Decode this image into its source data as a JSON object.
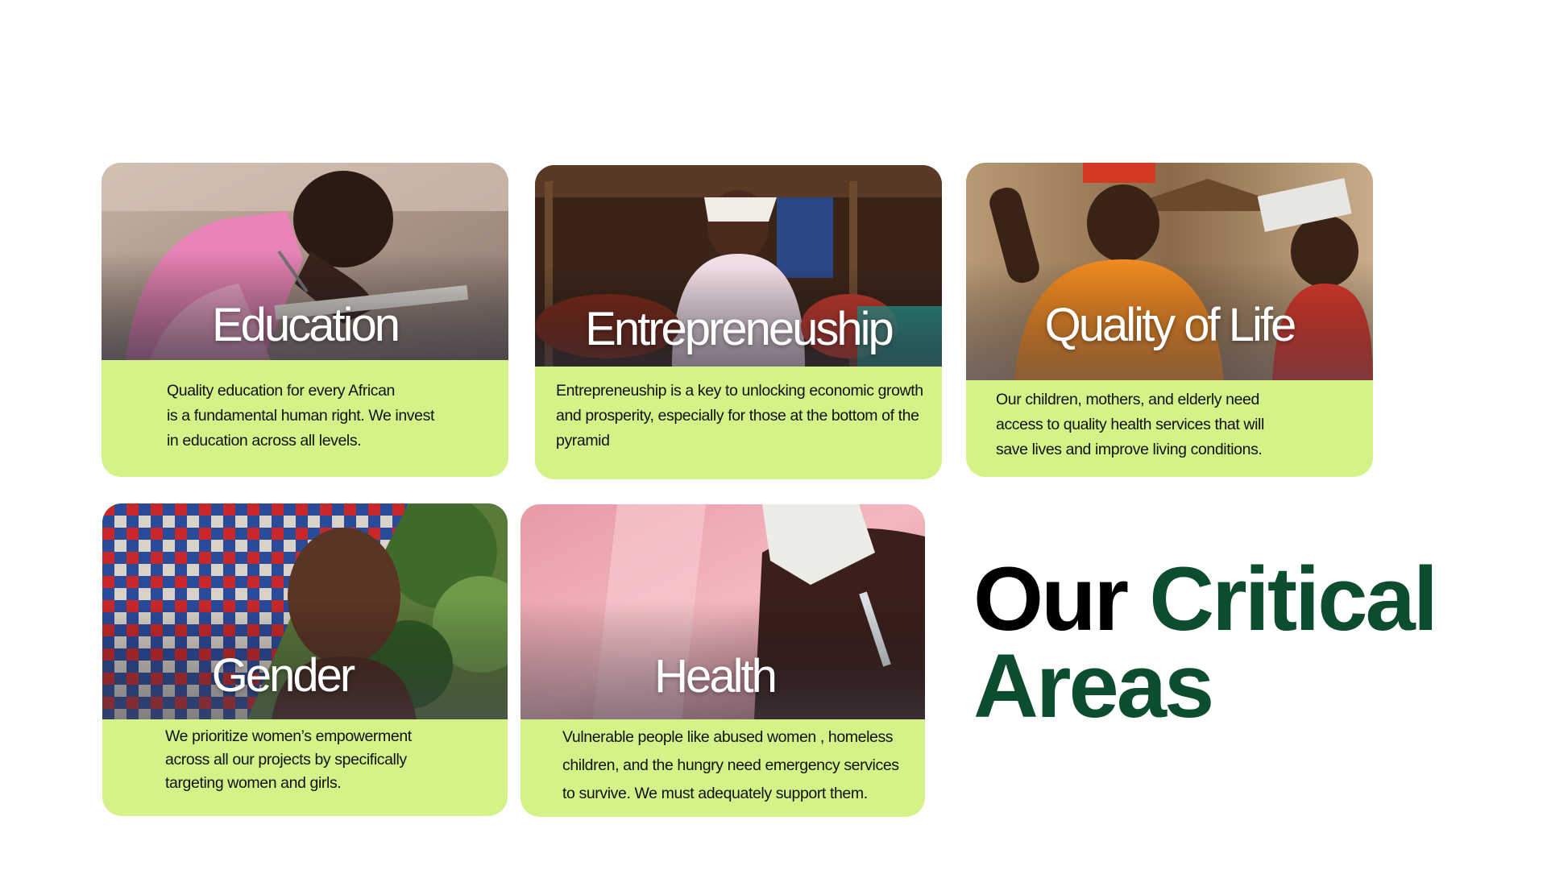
{
  "colors": {
    "card_background": "#d3f287",
    "headline_dark": "#000000",
    "headline_accent": "#0b4d2e"
  },
  "headline": {
    "word_1": "Our",
    "word_2": "Critical",
    "word_3": "Areas"
  },
  "cards": [
    {
      "title": "Education",
      "lines": [
        "Quality education for every African",
        "is a fundamental human right. We invest",
        "in education across all levels."
      ]
    },
    {
      "title": "Entrepreneuship",
      "lines": [
        "Entrepreneuship is a key to unlocking economic growth",
        "and prosperity, especially for those at the bottom of the",
        "pyramid"
      ]
    },
    {
      "title": "Quality of Life",
      "lines": [
        "Our children, mothers, and elderly need",
        "access to quality health services that will",
        "save lives and improve living conditions."
      ]
    },
    {
      "title": "Gender",
      "lines": [
        "We prioritize women’s empowerment",
        "across all our projects by specifically",
        "targeting women and girls."
      ]
    },
    {
      "title": "Health",
      "lines": [
        "Vulnerable people like abused women , homeless",
        "children, and the hungry need emergency services",
        "to survive. We must adequately support them."
      ]
    }
  ]
}
